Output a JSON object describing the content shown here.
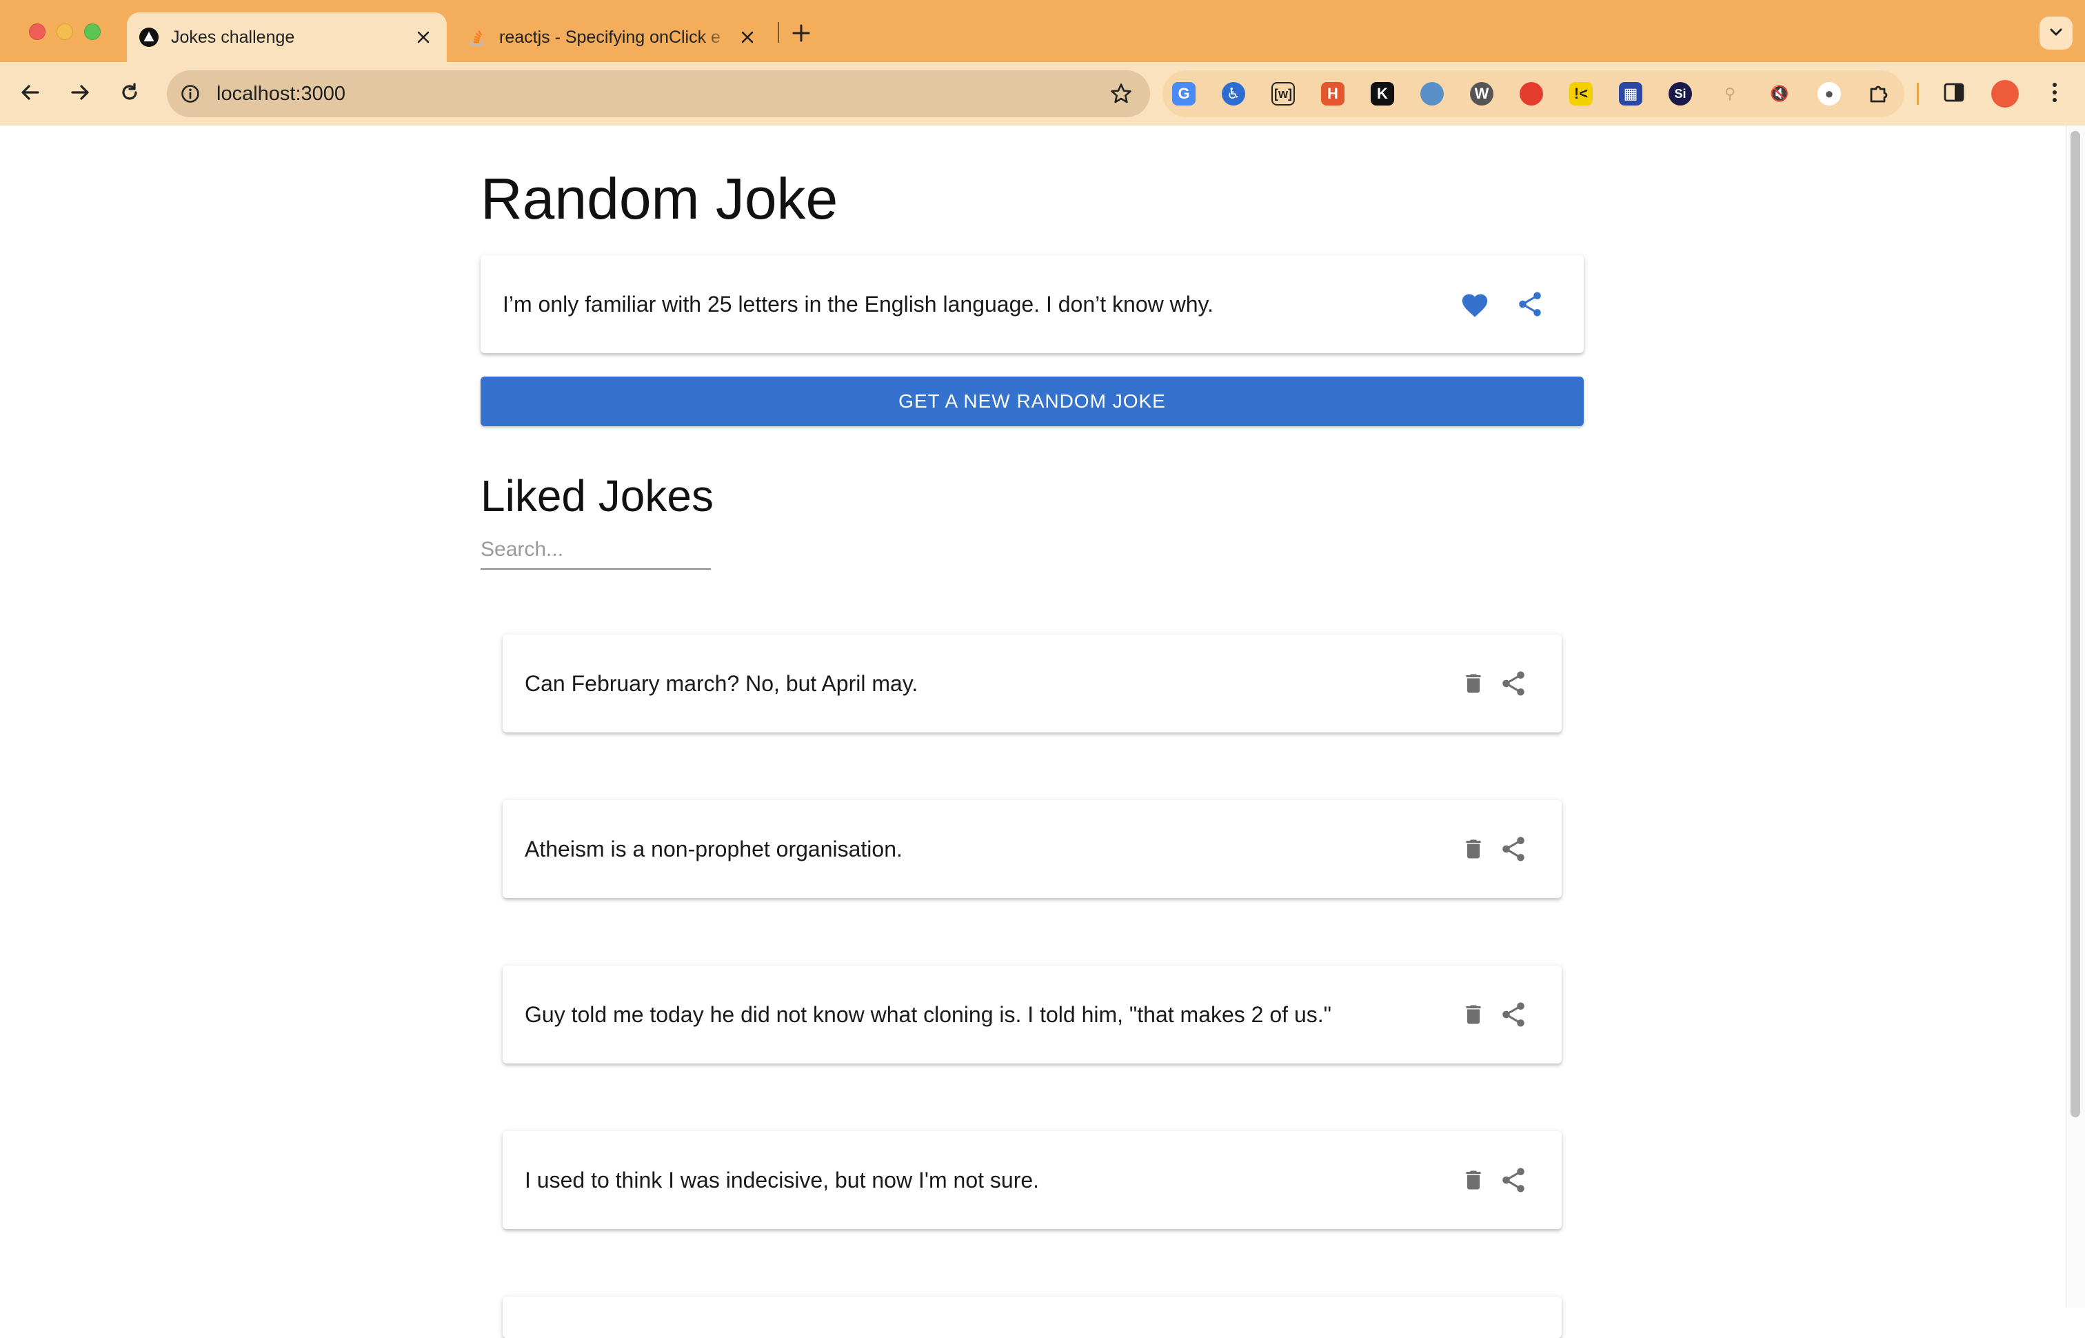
{
  "browser": {
    "tabs": [
      {
        "title": "Jokes challenge",
        "favicon": "triangle-logo-icon",
        "active": true
      },
      {
        "title": "reactjs - Specifying onClick e",
        "favicon": "stackoverflow-icon",
        "active": false
      }
    ],
    "new_tab_label": "+",
    "url": "localhost:3000",
    "accent_color": "#f4ae5b",
    "toolbar_color": "#fbe2bf"
  },
  "page": {
    "random_title": "Random Joke",
    "random_joke": "I’m only familiar with 25 letters in the English language. I don’t know why.",
    "new_joke_button": "GET A NEW RANDOM JOKE",
    "liked_title": "Liked Jokes",
    "search_placeholder": "Search...",
    "search_value": "",
    "liked_jokes": [
      {
        "text": "Can February march? No, but April may."
      },
      {
        "text": "Atheism is a non-prophet organisation."
      },
      {
        "text": "Guy told me today he did not know what cloning is. I told him, \"that makes 2 of us.\""
      },
      {
        "text": "I used to think I was indecisive, but now I'm not sure."
      }
    ],
    "primary_color": "#3572cd",
    "icon_gray": "#6e6e6e"
  }
}
